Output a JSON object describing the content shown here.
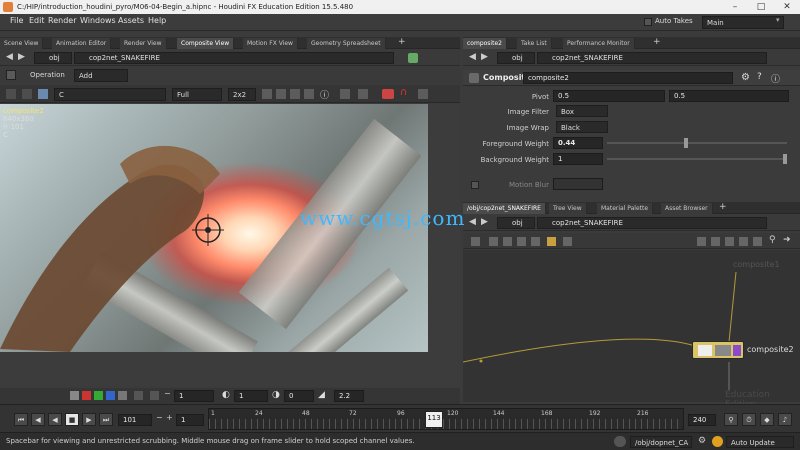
{
  "window": {
    "title": "C:/HIP/introduction_houdini_pyro/M06-04-Begin_a.hipnc - Houdini FX Education Edition 15.5.480"
  },
  "menu": [
    "File",
    "Edit",
    "Render",
    "Windows",
    "Assets",
    "Help"
  ],
  "topbar": {
    "auto_takes": "Auto Takes",
    "desktop": "Main"
  },
  "left_tabs": [
    "Scene View",
    "Animation Editor",
    "Render View",
    "Composite View",
    "Motion FX View",
    "Geometry Spreadsheet"
  ],
  "left_path": {
    "root": "obj",
    "node": "cop2net_SNAKEFIRE"
  },
  "operation": {
    "label": "Operation",
    "value": "Add"
  },
  "viewer_toolbar": {
    "plane": "C",
    "res": "Full",
    "zoom": "2x2"
  },
  "image_info": {
    "name": "composite2",
    "size": "640x360",
    "frame": "fr 101",
    "plane": "C"
  },
  "viewer_bottom": {
    "v1": "1",
    "v2": "1",
    "v3": "0",
    "v4": "2.2"
  },
  "right_tabs": [
    "composite2",
    "Take List",
    "Performance Monitor"
  ],
  "params": {
    "type": "Composite",
    "name": "composite2",
    "pivot_label": "Pivot",
    "pivot_x": "0.5",
    "pivot_y": "0.5",
    "filter_label": "Image Filter",
    "filter_value": "Box",
    "wrap_label": "Image Wrap",
    "wrap_value": "Black",
    "fg_label": "Foreground Weight",
    "fg_value": "0.44",
    "fg_fraction": 0.44,
    "bg_label": "Background Weight",
    "bg_value": "1",
    "bg_fraction": 1.0,
    "blur_label": "Motion Blur"
  },
  "network_tabs": [
    "/obj/cop2net_SNAKEFIRE",
    "Tree View",
    "Material Palette",
    "Asset Browser"
  ],
  "network_path": {
    "root": "obj",
    "node": "cop2net_SNAKEFIRE"
  },
  "network": {
    "node_above": "composite1",
    "node_label": "composite2",
    "watermark": "Education Edition"
  },
  "timeline": {
    "start": "101",
    "step": "1",
    "end": "240",
    "current": "113",
    "ticks": [
      "1",
      "24",
      "48",
      "72",
      "96",
      "120",
      "144",
      "168",
      "192",
      "216"
    ]
  },
  "status": {
    "message": "Spacebar for viewing and unrestricted scrubbing. Middle mouse drag on frame slider to hold scoped channel values.",
    "path": "/obj/dopnet_CA",
    "update": "Auto Update"
  },
  "watermark_site": "www.cgtsj.com"
}
